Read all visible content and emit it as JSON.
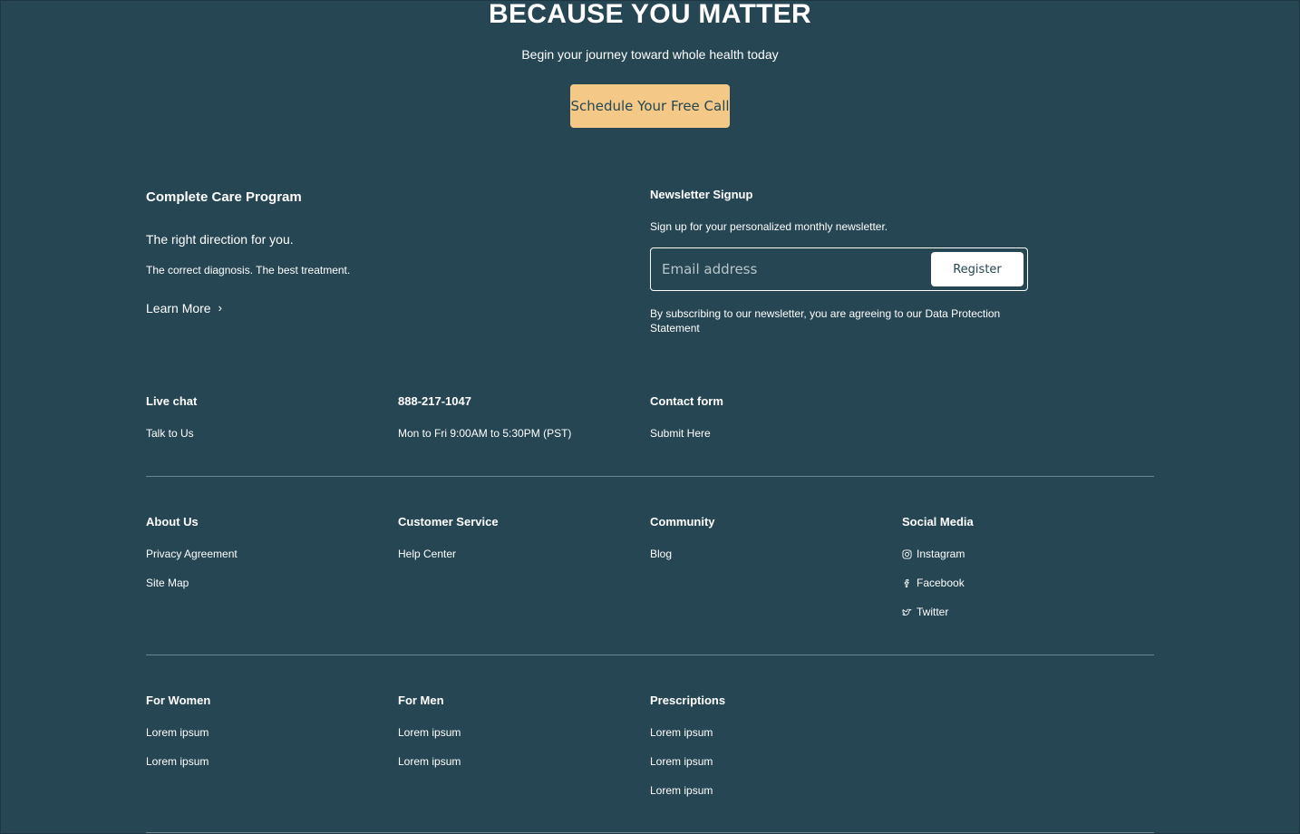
{
  "hero": {
    "title": "BECAUSE YOU MATTER",
    "subtitle": "Begin your journey toward whole health today",
    "cta_label": "Schedule Your Free Call"
  },
  "program": {
    "title": "Complete Care Program",
    "tagline": "The right direction for you.",
    "description": "The correct diagnosis. The best treatment.",
    "link_label": "Learn More",
    "link_icon": "chevron-right-icon"
  },
  "newsletter": {
    "title": "Newsletter Signup",
    "description": "Sign up for your personalized monthly newsletter.",
    "email_placeholder": "Email address",
    "email_value": "",
    "button_label": "Register",
    "disclaimer": "By subscribing to our newsletter, you are agreeing to our Data Protection Statement"
  },
  "contact": {
    "live_chat": {
      "title": "Live chat",
      "link": "Talk to Us"
    },
    "phone": {
      "title": "888-217-1047",
      "hours": "Mon to Fri 9:00AM to 5:30PM (PST)"
    },
    "contact_form": {
      "title": "Contact form",
      "link": "Submit Here"
    }
  },
  "footer_links": {
    "about": {
      "title": "About Us",
      "items": [
        "Privacy Agreement",
        "Site Map"
      ]
    },
    "customer_service": {
      "title": "Customer Service",
      "items": [
        "Help Center"
      ]
    },
    "community": {
      "title": "Community",
      "items": [
        "Blog"
      ]
    },
    "social": {
      "title": "Social Media",
      "items": [
        {
          "label": "Instagram",
          "icon": "instagram-icon"
        },
        {
          "label": "Facebook",
          "icon": "facebook-icon"
        },
        {
          "label": "Twitter",
          "icon": "twitter-icon"
        }
      ]
    }
  },
  "categories": {
    "women": {
      "title": "For Women",
      "items": [
        "Lorem ipsum",
        "Lorem ipsum"
      ]
    },
    "men": {
      "title": "For Men",
      "items": [
        "Lorem ipsum",
        "Lorem ipsum"
      ]
    },
    "prescriptions": {
      "title": "Prescriptions",
      "items": [
        "Lorem ipsum",
        "Lorem ipsum",
        "Lorem ipsum"
      ]
    }
  },
  "colors": {
    "background": "#264653",
    "cta": "#f4c987",
    "divider": "#6b8791",
    "text": "#ffffff"
  }
}
